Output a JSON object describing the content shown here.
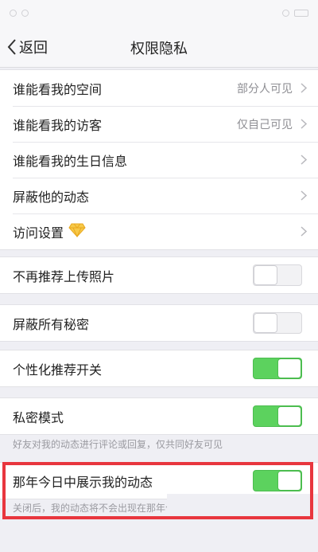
{
  "status_bar": {
    "time": "",
    "icons": [
      "signal-icon",
      "wifi-icon",
      "battery-icon"
    ]
  },
  "nav": {
    "back_label": "返回",
    "title": "权限隐私"
  },
  "group1": [
    {
      "label": "谁能看我的空间",
      "value": "部分人可见"
    },
    {
      "label": "谁能看我的访客",
      "value": "仅自己可见"
    },
    {
      "label": "谁能看我的生日信息",
      "value": ""
    },
    {
      "label": "屏蔽他的动态",
      "value": ""
    },
    {
      "label": "访问设置",
      "value": "",
      "icon": "diamond-icon"
    }
  ],
  "toggles": {
    "no_recommend_upload": {
      "label": "不再推荐上传照片",
      "on": false
    },
    "block_secrets": {
      "label": "屏蔽所有秘密",
      "on": false
    },
    "personalized_recommend": {
      "label": "个性化推荐开关",
      "on": true
    },
    "private_mode": {
      "label": "私密模式",
      "on": true,
      "note": "好友对我的动态进行评论或回复，仅共同好友可见"
    },
    "on_this_day": {
      "label": "那年今日中展示我的动态",
      "on": true,
      "note": "关闭后，我的动态将不会出现在那年今"
    }
  },
  "colors": {
    "toggle_on": "#5cd25e",
    "highlight": "#e8363e",
    "background": "#efeff4"
  }
}
